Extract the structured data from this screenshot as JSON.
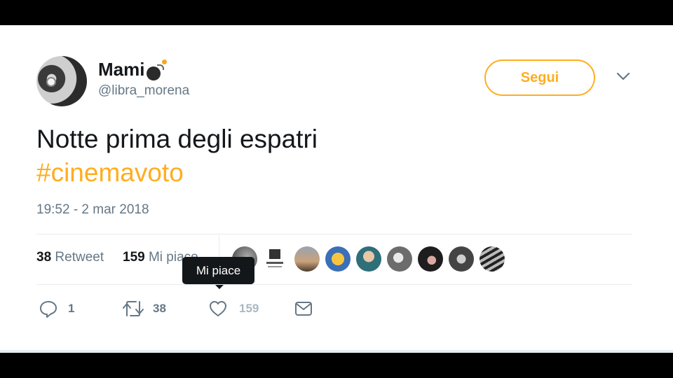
{
  "user": {
    "display_name": "Mami",
    "handle": "@libra_morena"
  },
  "follow_button": {
    "label": "Segui"
  },
  "tweet": {
    "text": "Notte prima degli espatri",
    "hashtag": "#cinemavoto",
    "timestamp": "19:52 - 2 mar 2018"
  },
  "stats": {
    "retweets_count": "38",
    "retweets_label": "Retweet",
    "likes_count": "159",
    "likes_label": "Mi piace"
  },
  "tooltip": {
    "text": "Mi piace"
  },
  "actions": {
    "reply_count": "1",
    "retweet_count": "38",
    "like_count": "159"
  },
  "colors": {
    "accent": "#ffad1f",
    "text_primary": "#14171a",
    "text_secondary": "#657786",
    "divider": "#e6ecf0"
  },
  "icons": [
    "bomb-icon",
    "chevron-down-icon",
    "reply-icon",
    "retweet-icon",
    "heart-icon",
    "message-icon"
  ]
}
